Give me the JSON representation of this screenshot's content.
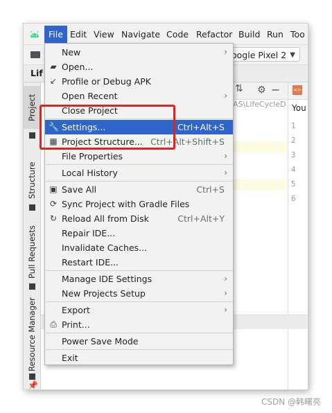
{
  "menubar": {
    "items": [
      "File",
      "Edit",
      "View",
      "Navigate",
      "Code",
      "Refactor",
      "Build",
      "Run",
      "Too"
    ]
  },
  "toolbar": {
    "device": "oogle Pixel 2"
  },
  "editor_tabs": {
    "project_tab": "Lif"
  },
  "side_tabs": {
    "project": "Project",
    "structure": "Structure",
    "pull_requests": "Pull Requests",
    "resource_manager": "Resource Manager"
  },
  "project_panel": {
    "path_fragment": "AS\\LifeCycleD"
  },
  "editor": {
    "text_fragment": "You",
    "line_numbers": [
      "1",
      "2",
      "3",
      "4",
      "5",
      "6"
    ]
  },
  "file_menu": {
    "items": [
      {
        "label": "New",
        "shortcut": "",
        "submenu": true,
        "icon": ""
      },
      {
        "label": "Open...",
        "shortcut": "",
        "submenu": false,
        "icon": "folder-icon"
      },
      {
        "label": "Profile or Debug APK",
        "shortcut": "",
        "submenu": false,
        "icon": "profile-apk-icon"
      },
      {
        "label": "Open Recent",
        "shortcut": "",
        "submenu": true,
        "icon": ""
      },
      {
        "label": "Close Project",
        "shortcut": "",
        "submenu": false,
        "icon": ""
      },
      {
        "label": "Settings...",
        "shortcut": "Ctrl+Alt+S",
        "submenu": false,
        "icon": "wrench-icon",
        "highlighted": true
      },
      {
        "label": "Project Structure...",
        "shortcut": "Ctrl+Alt+Shift+S",
        "submenu": false,
        "icon": "project-structure-icon"
      },
      {
        "label": "File Properties",
        "shortcut": "",
        "submenu": true,
        "icon": ""
      },
      {
        "label": "Local History",
        "shortcut": "",
        "submenu": true,
        "icon": ""
      },
      {
        "label": "Save All",
        "shortcut": "Ctrl+S",
        "submenu": false,
        "icon": "save-icon"
      },
      {
        "label": "Sync Project with Gradle Files",
        "shortcut": "",
        "submenu": false,
        "icon": "gradle-sync-icon"
      },
      {
        "label": "Reload All from Disk",
        "shortcut": "Ctrl+Alt+Y",
        "submenu": false,
        "icon": "reload-icon"
      },
      {
        "label": "Repair IDE...",
        "shortcut": "",
        "submenu": false,
        "icon": ""
      },
      {
        "label": "Invalidate Caches...",
        "shortcut": "",
        "submenu": false,
        "icon": ""
      },
      {
        "label": "Restart IDE...",
        "shortcut": "",
        "submenu": false,
        "icon": ""
      },
      {
        "label": "Manage IDE Settings",
        "shortcut": "",
        "submenu": true,
        "icon": ""
      },
      {
        "label": "New Projects Setup",
        "shortcut": "",
        "submenu": true,
        "icon": ""
      },
      {
        "label": "Export",
        "shortcut": "",
        "submenu": true,
        "icon": ""
      },
      {
        "label": "Print...",
        "shortcut": "",
        "submenu": false,
        "icon": "print-icon"
      },
      {
        "label": "Power Save Mode",
        "shortcut": "",
        "submenu": false,
        "icon": ""
      },
      {
        "label": "Exit",
        "shortcut": "",
        "submenu": false,
        "icon": ""
      }
    ]
  },
  "watermark": "CSDN @韩曙亮",
  "colors": {
    "accent": "#2f65ca",
    "highlight_box": "#e1221f",
    "menu_bg": "#f2f2f2"
  }
}
